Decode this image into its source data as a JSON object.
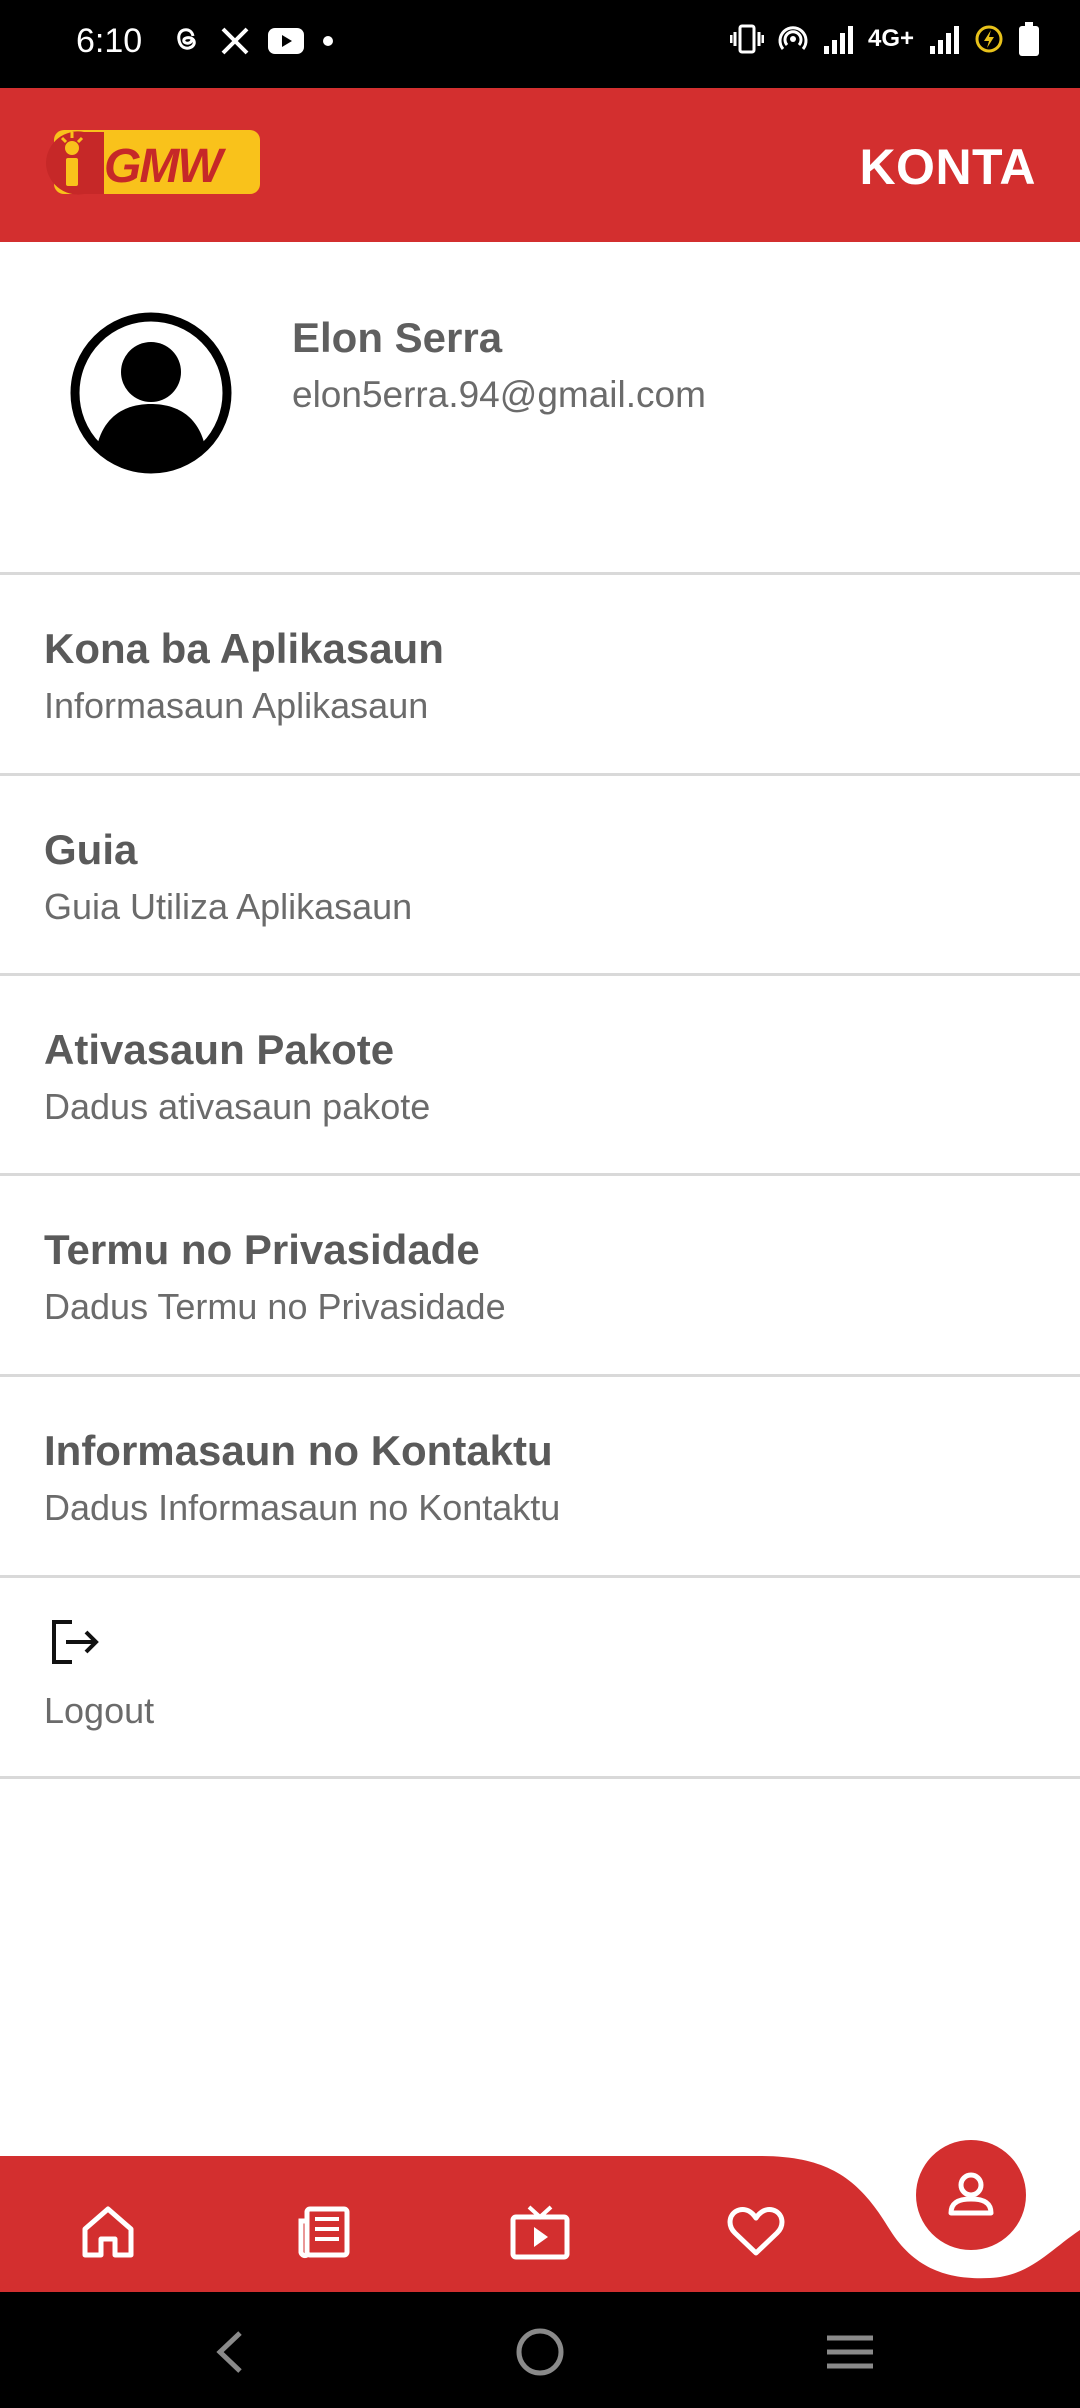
{
  "status_bar": {
    "time": "6:10",
    "left_icons": [
      "threads-icon",
      "x-icon",
      "youtube-icon",
      "dot-icon"
    ],
    "network_label": "4G+",
    "right_icons": [
      "vibrate-icon",
      "hotspot-icon",
      "signal-icon",
      "signal-icon-2",
      "battery-saver-icon",
      "battery-icon"
    ]
  },
  "header": {
    "logo_text": "iGMW",
    "title": "KONTA"
  },
  "profile": {
    "name": "Elon Serra",
    "email": "elon5erra.94@gmail.com"
  },
  "menu": {
    "items": [
      {
        "title": "Kona ba Aplikasaun",
        "subtitle": "Informasaun Aplikasaun"
      },
      {
        "title": "Guia",
        "subtitle": "Guia Utiliza Aplikasaun"
      },
      {
        "title": "Ativasaun Pakote",
        "subtitle": "Dadus ativasaun pakote"
      },
      {
        "title": "Termu no Privasidade",
        "subtitle": "Dadus Termu no Privasidade"
      },
      {
        "title": "Informasaun no Kontaktu",
        "subtitle": "Dadus Informasaun no Kontaktu"
      }
    ],
    "logout_label": "Logout"
  },
  "bottom_nav": {
    "items": [
      "home-icon",
      "news-icon",
      "tv-icon",
      "heart-icon"
    ],
    "active": "account-icon"
  },
  "colors": {
    "brand_red": "#d32f2f",
    "logo_yellow": "#f9c21b",
    "text_gray": "#5f5f5f",
    "divider": "#d9d9d9"
  }
}
